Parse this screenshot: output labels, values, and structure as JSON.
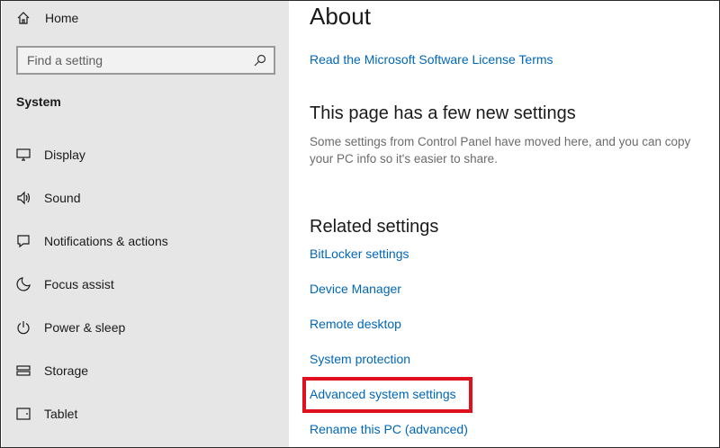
{
  "sidebar": {
    "home_label": "Home",
    "search_placeholder": "Find a setting",
    "section_title": "System",
    "items": [
      {
        "label": "Display",
        "icon": "monitor-icon"
      },
      {
        "label": "Sound",
        "icon": "speaker-icon"
      },
      {
        "label": "Notifications & actions",
        "icon": "notification-icon"
      },
      {
        "label": "Focus assist",
        "icon": "moon-icon"
      },
      {
        "label": "Power & sleep",
        "icon": "power-icon"
      },
      {
        "label": "Storage",
        "icon": "storage-icon"
      },
      {
        "label": "Tablet",
        "icon": "tablet-icon"
      }
    ]
  },
  "main": {
    "title": "About",
    "license_link": "Read the Microsoft Software License Terms",
    "new_settings_heading": "This page has a few new settings",
    "new_settings_desc": "Some settings from Control Panel have moved here, and you can copy your PC info so it's easier to share.",
    "related_heading": "Related settings",
    "related_links": [
      "BitLocker settings",
      "Device Manager",
      "Remote desktop",
      "System protection",
      "Advanced system settings",
      "Rename this PC (advanced)"
    ]
  },
  "colors": {
    "link": "#0067b8",
    "sidebar_bg": "#e6e6e6",
    "highlight": "#e0101f"
  }
}
